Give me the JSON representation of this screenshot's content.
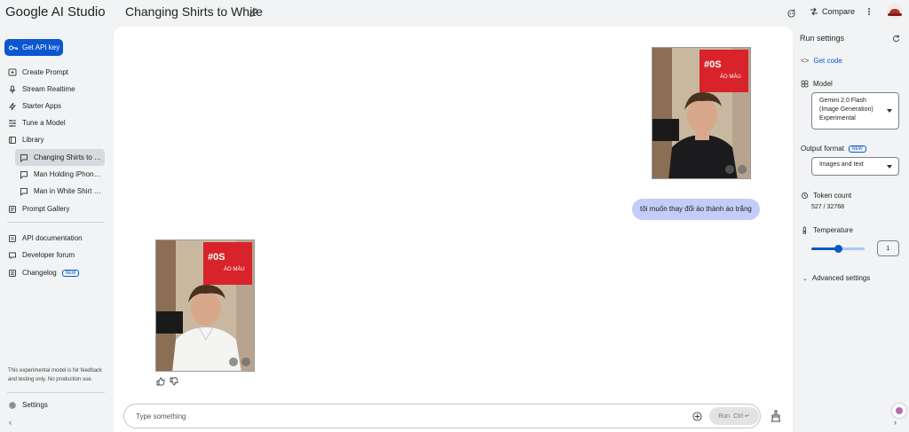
{
  "header": {
    "brand": "Google AI Studio",
    "title": "Changing Shirts to White",
    "compare_label": "Compare"
  },
  "sidebar": {
    "api_key_label": "Get API key",
    "items": [
      {
        "label": "Create Prompt",
        "icon": "plus-chat-icon"
      },
      {
        "label": "Stream Realtime",
        "icon": "mic-icon"
      },
      {
        "label": "Starter Apps",
        "icon": "bolt-icon"
      },
      {
        "label": "Tune a Model",
        "icon": "tune-icon"
      },
      {
        "label": "Library",
        "icon": "library-icon"
      }
    ],
    "library_items": [
      {
        "label": "Changing Shirts to W..."
      },
      {
        "label": "Man Holding iPhone 1..."
      },
      {
        "label": "Man in White Shirt wit..."
      }
    ],
    "gallery_label": "Prompt Gallery",
    "bottom_items": [
      {
        "label": "API documentation"
      },
      {
        "label": "Developer forum"
      },
      {
        "label": "Changelog",
        "badge": "NEW"
      }
    ],
    "disclaimer": "This experimental model is for feedback and testing only. No production use.",
    "settings_label": "Settings"
  },
  "chat": {
    "user_message": "tôi muốn thay đổi áo thành áo trắng",
    "input_placeholder": "Type something",
    "run_label": "Run",
    "run_shortcut": "Ctrl ↵"
  },
  "run_settings": {
    "title": "Run settings",
    "get_code_label": "Get code",
    "model_label": "Model",
    "model_value": "Gemini 2.0 Flash (Image Generation) Experimental",
    "output_format_label": "Output format",
    "output_format_badge": "NEW",
    "output_format_value": "Images and text",
    "token_count_label": "Token count",
    "token_count_value": "527 / 32768",
    "temperature_label": "Temperature",
    "temperature_value": "1",
    "temperature_fraction": 0.5,
    "advanced_label": "Advanced settings"
  },
  "colors": {
    "accent": "#0b57d0",
    "bubble": "#c3cdf7",
    "banner_red": "#d8232a"
  }
}
